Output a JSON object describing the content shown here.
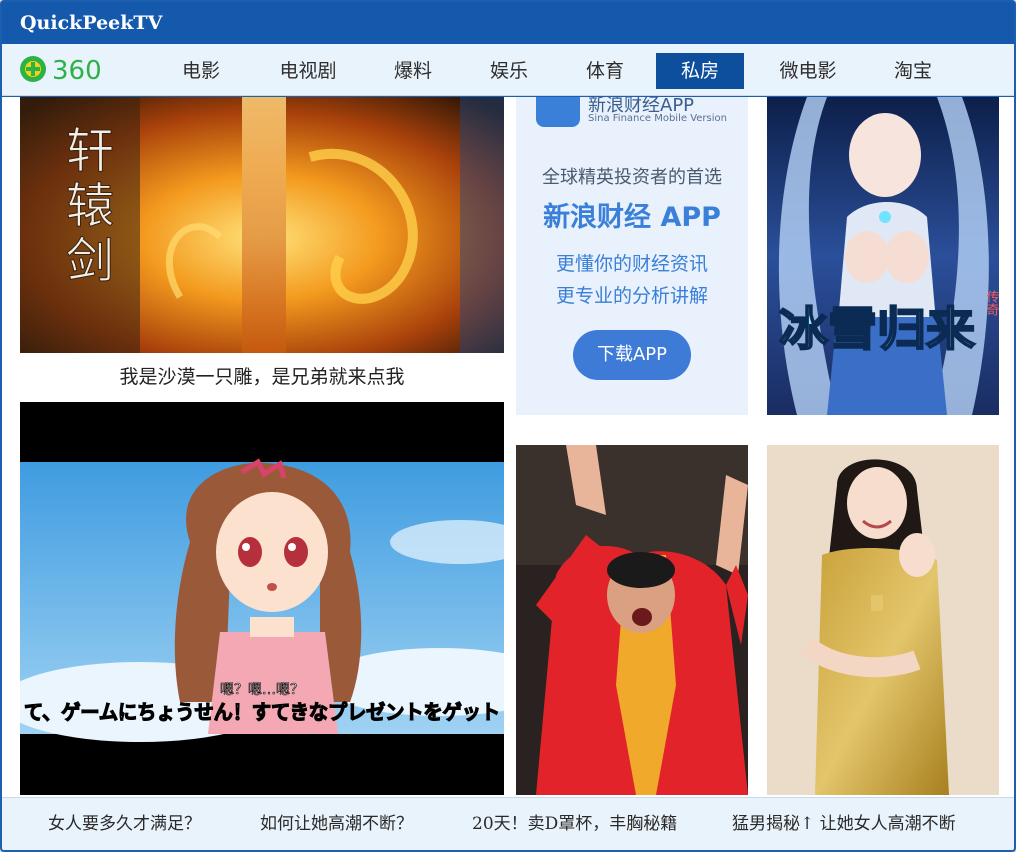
{
  "window": {
    "title": "QuickPeekTV"
  },
  "logo": {
    "text": "360"
  },
  "nav": {
    "items": [
      {
        "label": "电影"
      },
      {
        "label": "电视剧"
      },
      {
        "label": "爆料"
      },
      {
        "label": "娱乐"
      },
      {
        "label": "体育"
      },
      {
        "label": "私房",
        "active": true
      },
      {
        "label": "微电影"
      },
      {
        "label": "淘宝"
      }
    ]
  },
  "tiles": {
    "game_banner": {
      "calligraphy": "轩辕剑",
      "caption": "我是沙漠一只雕，是兄弟就来点我"
    },
    "sina_ad": {
      "app_name": "新浪财经APP",
      "app_sub": "Sina Finance Mobile Version",
      "tagline": "全球精英投资者的首选",
      "headline": "新浪财经 APP",
      "line1": "更懂你的财经资讯",
      "line2": "更专业的分析讲解",
      "button": "下载APP"
    },
    "fantasy_poster": {
      "title": "冰雪归来",
      "corner": "传奇"
    },
    "anime_video": {
      "speech": "嗯？嗯…嗯？",
      "subtitle": "て、ゲームにちょうせん！すてきなプレゼントをゲット"
    }
  },
  "footer": {
    "links": [
      {
        "label": "女人要多久才满足？"
      },
      {
        "label": "如何让她高潮不断？"
      },
      {
        "label": "20天！卖D罩杯，丰胸秘籍"
      },
      {
        "label": "猛男揭秘↑ 让她女人高潮不断"
      }
    ]
  },
  "colors": {
    "titlebar": "#1559ad",
    "nav_bg": "#e9f3fb",
    "nav_active": "#0d4f9c",
    "logo_green": "#2db24a",
    "logo_yellow": "#f5d20f",
    "sina_blue": "#3a7fd8"
  }
}
